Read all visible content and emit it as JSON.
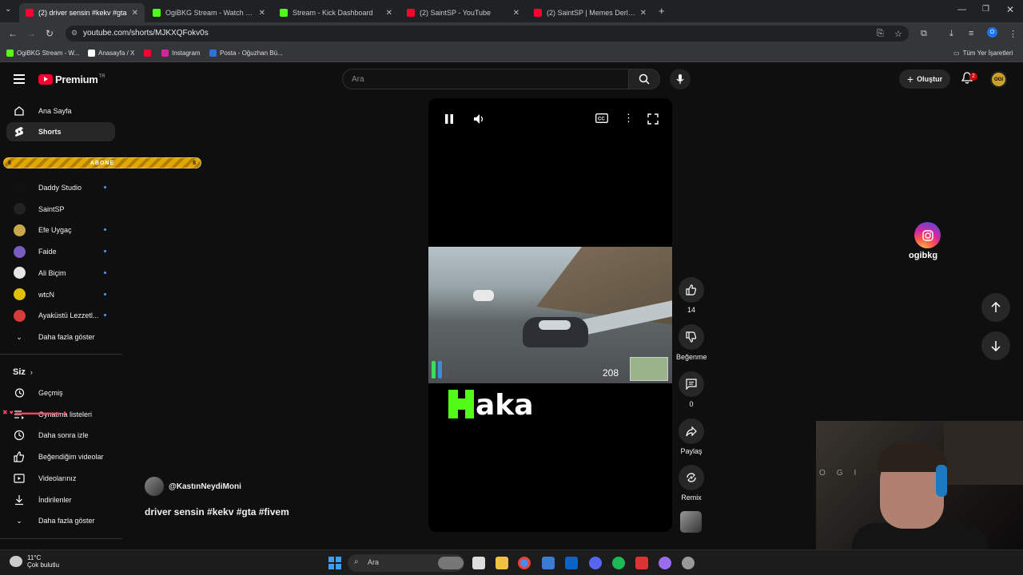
{
  "browser": {
    "tabs": [
      {
        "title": "(2) driver sensin #kekv #gta",
        "color": "#ff0033",
        "active": true
      },
      {
        "title": "OgiBKG Stream - Watch Live on",
        "color": "#53fc18",
        "active": false
      },
      {
        "title": "Stream - Kick Dashboard",
        "color": "#53fc18",
        "active": false
      },
      {
        "title": "(2) SaintSP - YouTube",
        "color": "#ff0033",
        "active": false
      },
      {
        "title": "(2) SaintSP | Memes Derleme #",
        "color": "#ff0033",
        "active": false
      }
    ],
    "new_tab": "+",
    "url": "youtube.com/shorts/MJKXQFokv0s",
    "bookmarks": [
      {
        "label": "OgiBKG Stream - W...",
        "color": "#53fc18"
      },
      {
        "label": "",
        "color": "#ff0033"
      },
      {
        "label": "Anasayfa / X",
        "color": "#ffffff"
      },
      {
        "label": "Instagram",
        "color": "#d6249f"
      },
      {
        "label": "Posta - Oğuzhan Bü...",
        "color": "#2f6fde"
      }
    ],
    "all_bookmarks": "Tüm Yer İşaretleri",
    "profile_initial": "O"
  },
  "header": {
    "logo_text": "Premium",
    "logo_region": "TR",
    "search_placeholder": "Ara",
    "create_label": "Oluştur",
    "notification_count": "2",
    "avatar_text": "OGI"
  },
  "sidebar": {
    "primary": [
      {
        "label": "Ana Sayfa"
      },
      {
        "label": "Shorts"
      }
    ],
    "abone_label": "ABONE",
    "abone_left": "8",
    "abone_right": "8",
    "subscriptions": [
      {
        "label": "Daddy Studio",
        "color": "#111111",
        "dot": true
      },
      {
        "label": "SaintSP",
        "color": "#222222",
        "dot": false
      },
      {
        "label": "Efe Uygaç",
        "color": "#c8a84a",
        "dot": true
      },
      {
        "label": "Faide",
        "color": "#7a5cc0",
        "dot": true
      },
      {
        "label": "Ali Biçim",
        "color": "#e6e6e6",
        "dot": true
      },
      {
        "label": "wtcN",
        "color": "#e0c000",
        "dot": true
      },
      {
        "label": "Ayaküstü Lezzetl...",
        "color": "#d93a3a",
        "dot": true
      }
    ],
    "show_more_1": "Daha fazla göster",
    "you_section": "Siz",
    "you_items": [
      {
        "label": "Geçmiş"
      },
      {
        "label": "Oynatma listeleri"
      },
      {
        "label": "Daha sonra izle"
      },
      {
        "label": "Beğendiğim videolar"
      },
      {
        "label": "Videolarınız"
      },
      {
        "label": "İndirilenler"
      }
    ],
    "show_more_2": "Daha fazla göster"
  },
  "player": {
    "speed": "208",
    "kick_text": "aka"
  },
  "actions": {
    "likes": "14",
    "dislike_label": "Beğenme",
    "comments": "0",
    "share_label": "Paylaş",
    "remix_label": "Remix"
  },
  "short": {
    "channel": "@KastınNeydiMoni",
    "title": "driver sensin #kekv #gta #fivem"
  },
  "overlay": {
    "instagram_handle": "ogibkg"
  },
  "taskbar": {
    "temperature": "11°C",
    "weather": "Çok bulutlu",
    "search_placeholder": "Ara"
  }
}
